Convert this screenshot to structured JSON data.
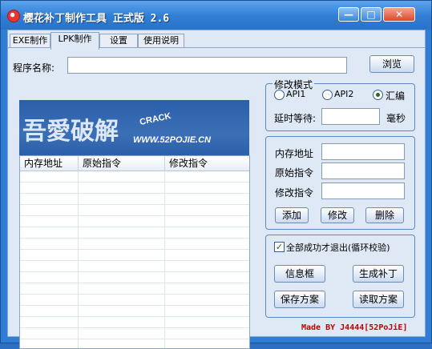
{
  "window": {
    "title": "樱花补丁制作工具 正式版 2.6",
    "controls": {
      "minimize": "—",
      "maximize": "□",
      "close": "✕"
    }
  },
  "tabs": [
    {
      "label": "EXE制作",
      "active": false
    },
    {
      "label": "LPK制作",
      "active": true
    },
    {
      "label": "设置",
      "active": false
    },
    {
      "label": "使用说明",
      "active": false
    }
  ],
  "program": {
    "label": "程序名称:",
    "value": "",
    "browse_label": "浏览"
  },
  "banner": {
    "logo_text": "吾愛破解",
    "crack_text": "CRACK",
    "url_text": "WWW.52POJIE.CN"
  },
  "patch_list": {
    "columns": [
      "内存地址",
      "原始指令",
      "修改指令"
    ],
    "rows": []
  },
  "mode_group": {
    "title": "修改模式",
    "options": [
      {
        "label": "API1",
        "selected": false
      },
      {
        "label": "API2",
        "selected": false
      },
      {
        "label": "汇编",
        "selected": true
      }
    ],
    "delay_label": "延时等待:",
    "delay_value": "",
    "delay_unit": "毫秒"
  },
  "edit_group": {
    "address_label": "内存地址",
    "address_value": "",
    "original_label": "原始指令",
    "original_value": "",
    "modified_label": "修改指令",
    "modified_value": "",
    "add_label": "添加",
    "modify_label": "修改",
    "delete_label": "删除"
  },
  "action_group": {
    "checkbox_label": "全部成功才退出(循环校验)",
    "checkbox_checked": true,
    "info_box_label": "信息框",
    "generate_label": "生成补丁",
    "save_label": "保存方案",
    "load_label": "读取方案"
  },
  "footer": "Made BY J4444[52PoJiE]",
  "colors": {
    "titlebar": "#2f7dd4",
    "client_bg": "#dfe9f5",
    "footer_text": "#c00000",
    "group_border": "#5d88c4"
  }
}
